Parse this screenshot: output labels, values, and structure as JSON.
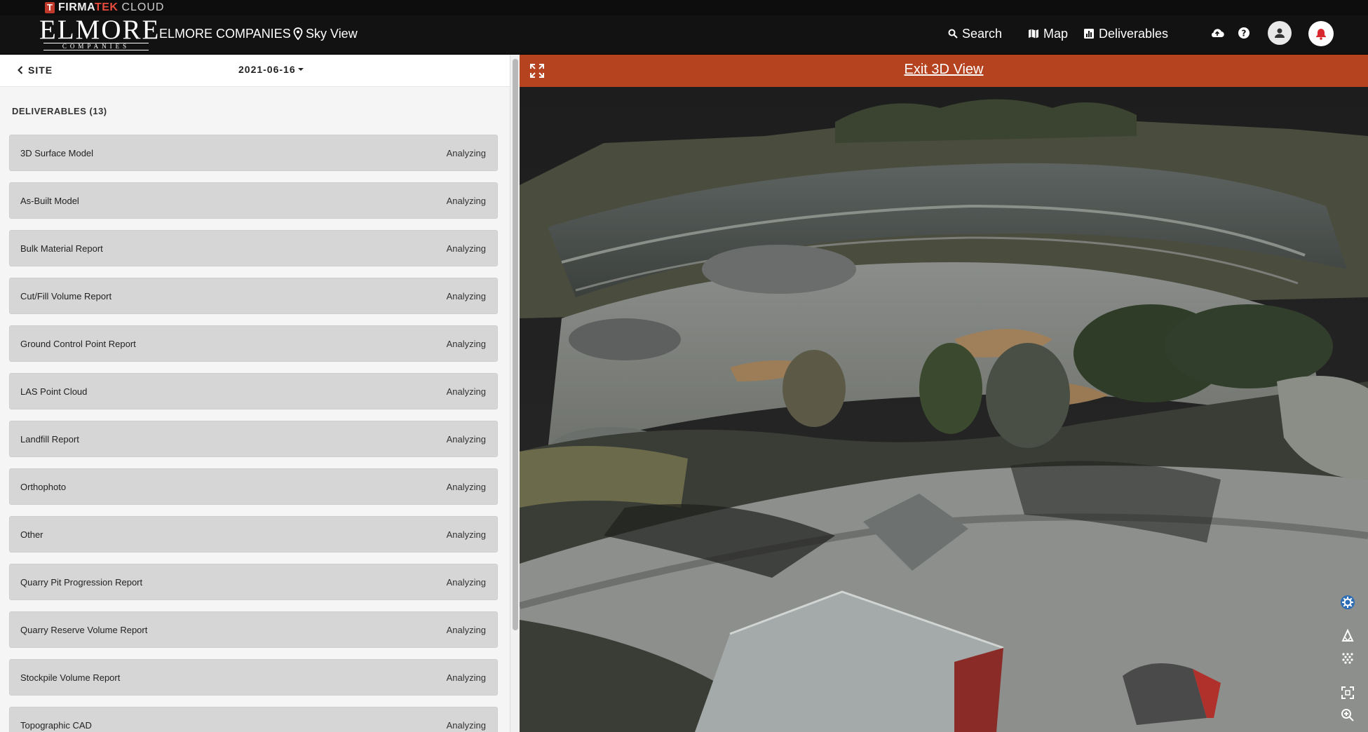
{
  "brand": {
    "prefix": "FIRMA",
    "accent": "TEK",
    "suffix": "CLOUD",
    "mark": "T"
  },
  "header": {
    "logo_main": "ELMORE",
    "logo_sub": "COMPANIES",
    "company": "ELMORE COMPANIES",
    "view_label": "Sky View",
    "nav": {
      "search": "Search",
      "map": "Map",
      "deliverables": "Deliverables"
    }
  },
  "panel": {
    "back_label": "SITE",
    "date": "2021-06-16",
    "section_title": "DELIVERABLES (13)",
    "items": [
      {
        "name": "3D Surface Model",
        "status": "Analyzing"
      },
      {
        "name": "As-Built Model",
        "status": "Analyzing"
      },
      {
        "name": "Bulk Material Report",
        "status": "Analyzing"
      },
      {
        "name": "Cut/Fill Volume Report",
        "status": "Analyzing"
      },
      {
        "name": "Ground Control Point Report",
        "status": "Analyzing"
      },
      {
        "name": "LAS Point Cloud",
        "status": "Analyzing"
      },
      {
        "name": "Landfill Report",
        "status": "Analyzing"
      },
      {
        "name": "Orthophoto",
        "status": "Analyzing"
      },
      {
        "name": "Other",
        "status": "Analyzing"
      },
      {
        "name": "Quarry Pit Progression Report",
        "status": "Analyzing"
      },
      {
        "name": "Quarry Reserve Volume Report",
        "status": "Analyzing"
      },
      {
        "name": "Stockpile Volume Report",
        "status": "Analyzing"
      },
      {
        "name": "Topographic CAD",
        "status": "Analyzing"
      }
    ]
  },
  "viewer": {
    "exit_label": "Exit 3D View"
  },
  "colors": {
    "accent": "#b5431f",
    "header_bg": "#121212",
    "bell": "#d9272e"
  },
  "icons": [
    "location-pin-icon",
    "search-icon",
    "map-icon",
    "chart-icon",
    "cloud-upload-icon",
    "help-icon",
    "user-icon",
    "bell-icon",
    "chevron-left-icon",
    "caret-down-icon",
    "expand-icon",
    "settings-icon",
    "terrain-icon",
    "pointcloud-icon",
    "frame-icon",
    "zoom-in-icon"
  ]
}
